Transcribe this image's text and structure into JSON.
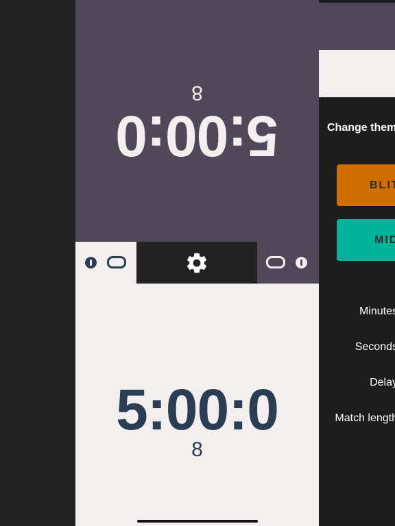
{
  "top_player": {
    "time": "5:00:0",
    "fraction": "8"
  },
  "bottom_player": {
    "time": "5:00:0",
    "fraction": "8"
  },
  "toolbar": {
    "settings_icon": "gear-icon"
  },
  "settings_panel": {
    "change_theme_label": "Change them",
    "themes": [
      {
        "label": "BLIT",
        "color": "#d06e00"
      },
      {
        "label": "MID",
        "color": "#00b39a"
      }
    ],
    "fields": [
      "Minutes",
      "Seconds",
      "Delay",
      "Match length"
    ]
  },
  "colors": {
    "top_bg": "#524759",
    "bottom_bg": "#f4efef",
    "text_dark": "#2b3d52"
  }
}
